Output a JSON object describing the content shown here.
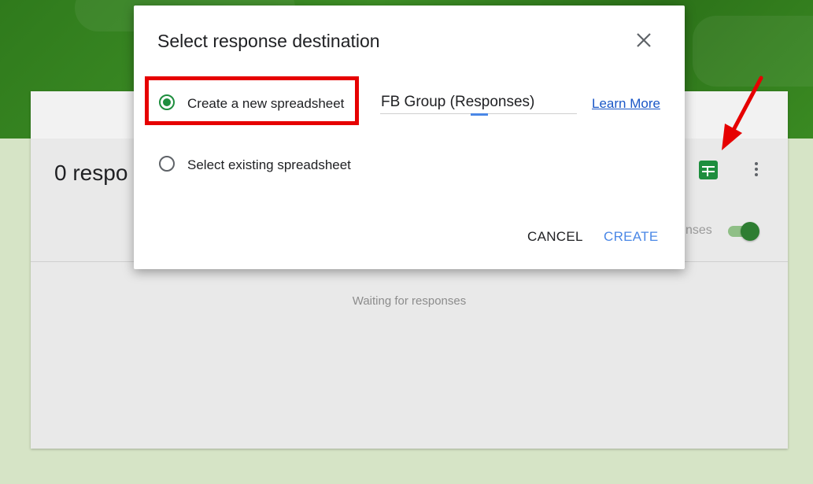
{
  "background": {
    "response_count": "0 respo",
    "accepting_label": "nses",
    "waiting_text": "Waiting for responses",
    "sheets_icon": "google-sheets-icon",
    "more_icon": "more-vert-icon"
  },
  "dialog": {
    "title": "Select response destination",
    "close_icon": "close-icon",
    "options": [
      {
        "label": "Create a new spreadsheet",
        "selected": true
      },
      {
        "label": "Select existing spreadsheet",
        "selected": false
      }
    ],
    "spreadsheet_name": "FB Group (Responses)",
    "learn_more": "Learn More",
    "cancel_label": "CANCEL",
    "create_label": "CREATE"
  },
  "colors": {
    "accent_green": "#1e8e3e",
    "create_blue": "#4a87e6",
    "highlight_red": "#e60000",
    "header_green": "#2f7a1c"
  }
}
